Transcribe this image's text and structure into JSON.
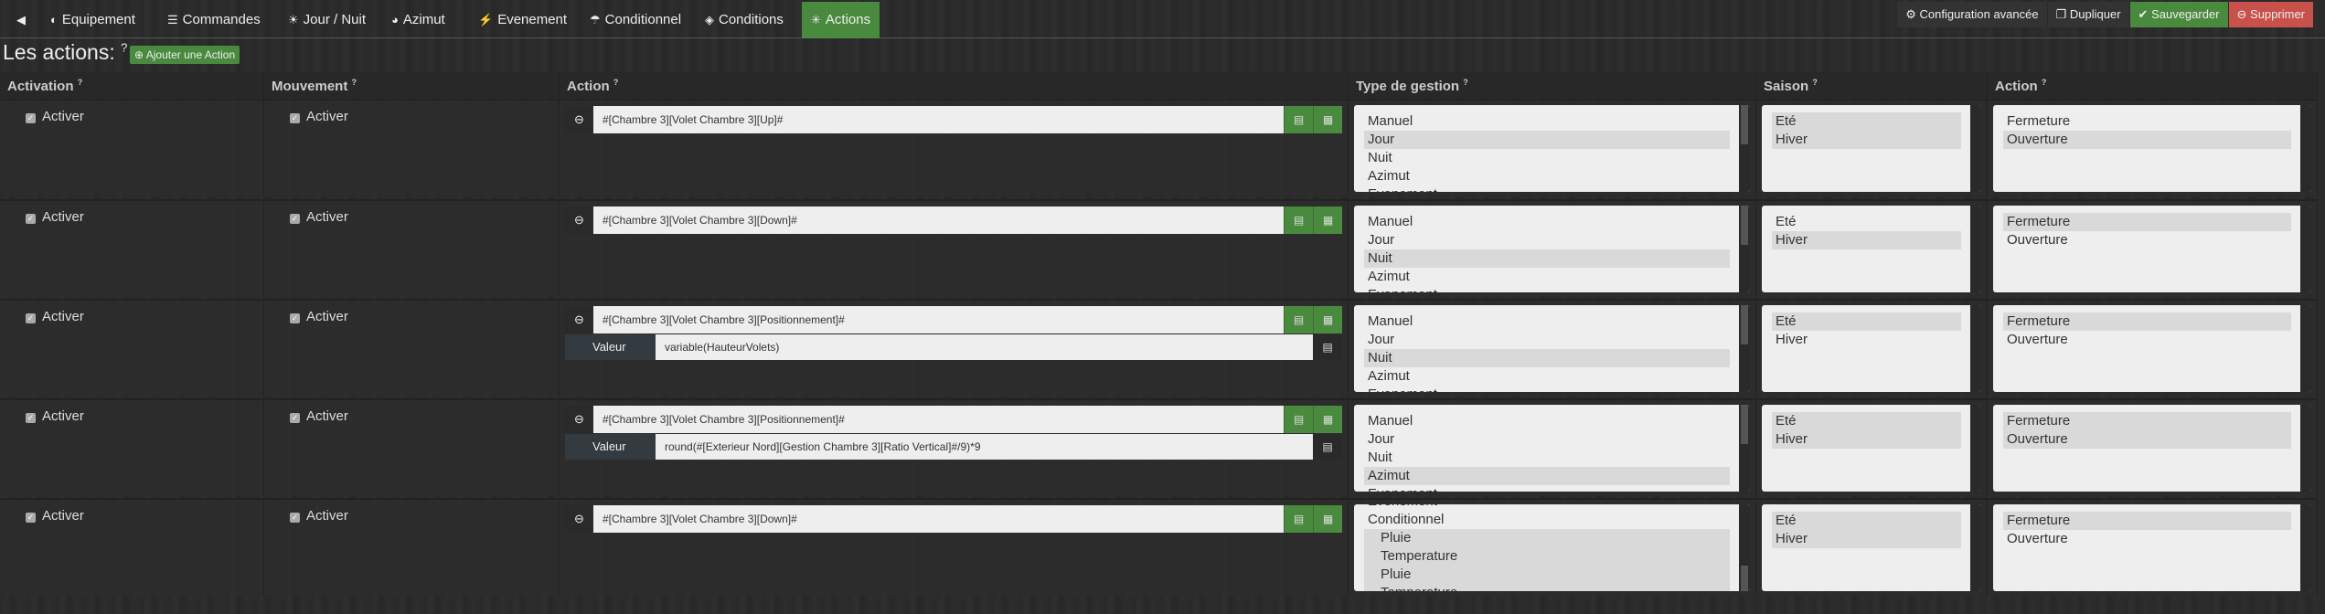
{
  "nav": {
    "tabs": [
      {
        "icon": "back-arrow-icon",
        "glyph": "◀",
        "label": ""
      },
      {
        "icon": "tachometer-icon",
        "glyph": "◐",
        "label": "Equipement"
      },
      {
        "icon": "list-icon",
        "glyph": "☰",
        "label": "Commandes"
      },
      {
        "icon": "sun-icon",
        "glyph": "☀",
        "label": "Jour / Nuit"
      },
      {
        "icon": "globe-icon",
        "glyph": "◕",
        "label": "Azimut"
      },
      {
        "icon": "running-icon",
        "glyph": "⚡",
        "label": "Evenement"
      },
      {
        "icon": "umbrella-icon",
        "glyph": "☂",
        "label": "Conditionnel"
      },
      {
        "icon": "cube-icon",
        "glyph": "◈",
        "label": "Conditions"
      },
      {
        "icon": "asterisk-icon",
        "glyph": "✳",
        "label": "Actions",
        "active": true
      }
    ],
    "buttons": {
      "config": "Configuration avancée",
      "duplicate": "Dupliquer",
      "save": "Sauvegarder",
      "delete": "Supprimer"
    }
  },
  "section": {
    "title": "Les actions:",
    "help": "?",
    "add_button": "Ajouter une Action"
  },
  "headers": [
    "Activation",
    "Mouvement",
    "Action",
    "Type de gestion",
    "Saison",
    "Action"
  ],
  "help_glyph": "?",
  "type_options": [
    "Manuel",
    "Jour",
    "Nuit",
    "Azimut",
    "Evenement",
    "Conditionnel",
    "Pluie",
    "Temperature",
    "Pluie",
    "Temperature"
  ],
  "saison_options": [
    "Eté",
    "Hiver"
  ],
  "action_options": [
    "Fermeture",
    "Ouverture"
  ],
  "check_label": "Activer",
  "value_label": "Valeur",
  "rows": [
    {
      "activation": true,
      "mouvement": true,
      "cmd": "#[Chambre 3][Volet Chambre 3][Up]#",
      "value": null,
      "type_sel": [
        1
      ],
      "saison_sel": [
        0,
        1
      ],
      "action_sel": [
        1
      ]
    },
    {
      "activation": true,
      "mouvement": true,
      "cmd": "#[Chambre 3][Volet Chambre 3][Down]#",
      "value": null,
      "type_sel": [
        2
      ],
      "saison_sel": [
        1
      ],
      "action_sel": [
        0
      ]
    },
    {
      "activation": true,
      "mouvement": true,
      "cmd": "#[Chambre 3][Volet Chambre 3][Positionnement]#",
      "value": "variable(HauteurVolets)",
      "type_sel": [
        2
      ],
      "saison_sel": [
        0
      ],
      "action_sel": [
        0
      ]
    },
    {
      "activation": true,
      "mouvement": true,
      "cmd": "#[Chambre 3][Volet Chambre 3][Positionnement]#",
      "value": "round(#[Exterieur Nord][Gestion Chambre 3][Ratio Vertical]#/9)*9",
      "type_sel": [
        3
      ],
      "saison_sel": [
        0,
        1
      ],
      "action_sel": [
        0,
        1
      ]
    },
    {
      "activation": true,
      "mouvement": true,
      "cmd": "#[Chambre 3][Volet Chambre 3][Down]#",
      "value": null,
      "type_sel": [
        6,
        7,
        8,
        9
      ],
      "type_scrolled": true,
      "saison_sel": [
        0,
        1
      ],
      "action_sel": [
        0
      ]
    }
  ]
}
